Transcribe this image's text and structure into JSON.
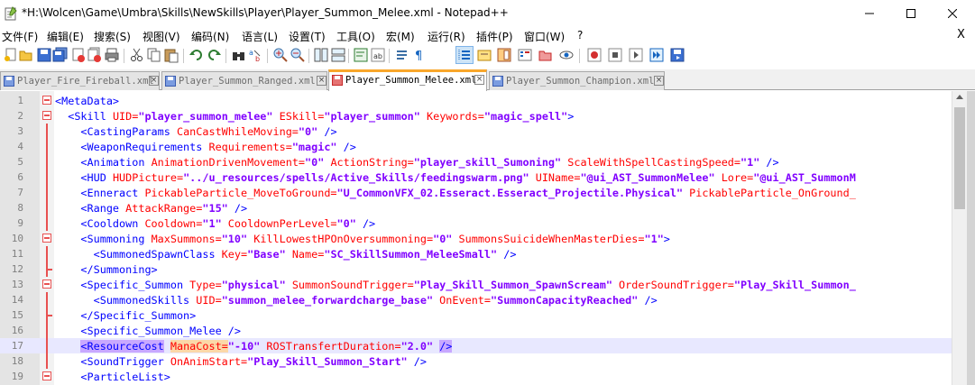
{
  "window": {
    "title": "*H:\\Wolcen\\Game\\Umbra\\Skills\\NewSkills\\Player\\Player_Summon_Melee.xml - Notepad++",
    "minimize": "—",
    "maximize": "☐",
    "close": "✕"
  },
  "menu": {
    "items": [
      "文件(F)",
      "编辑(E)",
      "搜索(S)",
      "视图(V)",
      "编码(N)",
      "语言(L)",
      "设置(T)",
      "工具(O)",
      "宏(M)",
      "运行(R)",
      "插件(P)",
      "窗口(W)",
      "?"
    ],
    "close_doc": "X"
  },
  "tabs": [
    {
      "label": "Player_Fire_Fireball.xml",
      "active": false
    },
    {
      "label": "Player_Summon_Ranged.xml",
      "active": false
    },
    {
      "label": "Player_Summon_Melee.xml",
      "active": true
    },
    {
      "label": "Player_Summon_Champion.xml",
      "active": false
    }
  ],
  "editor": {
    "current_line": 17,
    "lines": [
      {
        "n": "1",
        "parts": [
          [
            "t",
            "<MetaData>"
          ]
        ]
      },
      {
        "n": "2",
        "parts": [
          [
            "p",
            "  "
          ],
          [
            "t",
            "<Skill "
          ],
          [
            "a",
            "UID="
          ],
          [
            "v",
            "\"player_summon_melee\""
          ],
          [
            "a",
            " ESkill="
          ],
          [
            "v",
            "\"player_summon\""
          ],
          [
            "a",
            " Keywords="
          ],
          [
            "v",
            "\"magic_spell\""
          ],
          [
            "t",
            ">"
          ]
        ]
      },
      {
        "n": "3",
        "parts": [
          [
            "p",
            "    "
          ],
          [
            "t",
            "<CastingParams "
          ],
          [
            "a",
            "CanCastWhileMoving="
          ],
          [
            "v",
            "\"0\""
          ],
          [
            "t",
            " />"
          ]
        ]
      },
      {
        "n": "4",
        "parts": [
          [
            "p",
            "    "
          ],
          [
            "t",
            "<WeaponRequirements "
          ],
          [
            "a",
            "Requirements="
          ],
          [
            "v",
            "\"magic\""
          ],
          [
            "t",
            " />"
          ]
        ]
      },
      {
        "n": "5",
        "parts": [
          [
            "p",
            "    "
          ],
          [
            "t",
            "<Animation "
          ],
          [
            "a",
            "AnimationDrivenMovement="
          ],
          [
            "v",
            "\"0\""
          ],
          [
            "a",
            " ActionString="
          ],
          [
            "v",
            "\"player_skill_Sumoning\""
          ],
          [
            "a",
            " ScaleWithSpellCastingSpeed="
          ],
          [
            "v",
            "\"1\""
          ],
          [
            "t",
            " />"
          ]
        ]
      },
      {
        "n": "6",
        "parts": [
          [
            "p",
            "    "
          ],
          [
            "t",
            "<HUD "
          ],
          [
            "a",
            "HUDPicture="
          ],
          [
            "v",
            "\"../u_resources/spells/Active_Skills/feedingswarm.png\""
          ],
          [
            "a",
            " UIName="
          ],
          [
            "v",
            "\"@ui_AST_SummonMelee\""
          ],
          [
            "a",
            " Lore="
          ],
          [
            "v",
            "\"@ui_AST_SummonM"
          ]
        ]
      },
      {
        "n": "7",
        "parts": [
          [
            "p",
            "    "
          ],
          [
            "t",
            "<Enneract "
          ],
          [
            "a",
            "PickableParticle_MoveToGround="
          ],
          [
            "v",
            "\"U_CommonVFX_02.Esseract.Esseract_Projectile.Physical\""
          ],
          [
            "a",
            " PickableParticle_OnGround_"
          ]
        ]
      },
      {
        "n": "8",
        "parts": [
          [
            "p",
            "    "
          ],
          [
            "t",
            "<Range "
          ],
          [
            "a",
            "AttackRange="
          ],
          [
            "v",
            "\"15\""
          ],
          [
            "t",
            " />"
          ]
        ]
      },
      {
        "n": "9",
        "parts": [
          [
            "p",
            "    "
          ],
          [
            "t",
            "<Cooldown "
          ],
          [
            "a",
            "Cooldown="
          ],
          [
            "v",
            "\"1\""
          ],
          [
            "a",
            " CooldownPerLevel="
          ],
          [
            "v",
            "\"0\""
          ],
          [
            "t",
            " />"
          ]
        ]
      },
      {
        "n": "10",
        "parts": [
          [
            "p",
            "    "
          ],
          [
            "t",
            "<Summoning "
          ],
          [
            "a",
            "MaxSummons="
          ],
          [
            "v",
            "\"10\""
          ],
          [
            "a",
            " KillLowestHPOnOversummoning="
          ],
          [
            "v",
            "\"0\""
          ],
          [
            "a",
            " SummonsSuicideWhenMasterDies="
          ],
          [
            "v",
            "\"1\""
          ],
          [
            "t",
            ">"
          ]
        ]
      },
      {
        "n": "11",
        "parts": [
          [
            "p",
            "      "
          ],
          [
            "t",
            "<SummonedSpawnClass "
          ],
          [
            "a",
            "Key="
          ],
          [
            "v",
            "\"Base\""
          ],
          [
            "a",
            " Name="
          ],
          [
            "v",
            "\"SC_SkillSummon_MeleeSmall\""
          ],
          [
            "t",
            " />"
          ]
        ]
      },
      {
        "n": "12",
        "parts": [
          [
            "p",
            "    "
          ],
          [
            "t",
            "</Summoning>"
          ]
        ]
      },
      {
        "n": "13",
        "parts": [
          [
            "p",
            "    "
          ],
          [
            "t",
            "<Specific_Summon "
          ],
          [
            "a",
            "Type="
          ],
          [
            "v",
            "\"physical\""
          ],
          [
            "a",
            " SummonSoundTrigger="
          ],
          [
            "v",
            "\"Play_Skill_Summon_SpawnScream\""
          ],
          [
            "a",
            " OrderSoundTrigger="
          ],
          [
            "v",
            "\"Play_Skill_Summon_"
          ]
        ]
      },
      {
        "n": "14",
        "parts": [
          [
            "p",
            "      "
          ],
          [
            "t",
            "<SummonedSkills "
          ],
          [
            "a",
            "UID="
          ],
          [
            "v",
            "\"summon_melee_forwardcharge_base\""
          ],
          [
            "a",
            " OnEvent="
          ],
          [
            "v",
            "\"SummonCapacityReached\""
          ],
          [
            "t",
            " />"
          ]
        ]
      },
      {
        "n": "15",
        "parts": [
          [
            "p",
            "    "
          ],
          [
            "t",
            "</Specific_Summon>"
          ]
        ]
      },
      {
        "n": "16",
        "parts": [
          [
            "p",
            "    "
          ],
          [
            "t",
            "<Specific_Summon_Melee />"
          ]
        ]
      },
      {
        "n": "17",
        "parts": [
          [
            "p",
            "    "
          ],
          [
            "tm",
            "<ResourceCost"
          ],
          [
            "t",
            " "
          ],
          [
            "ao",
            "ManaCost="
          ],
          [
            "v",
            "\"-10\""
          ],
          [
            "a",
            " ROSTransfertDuration="
          ],
          [
            "v",
            "\"2.0\""
          ],
          [
            "t",
            " "
          ],
          [
            "tm",
            "/>"
          ]
        ]
      },
      {
        "n": "18",
        "parts": [
          [
            "p",
            "    "
          ],
          [
            "t",
            "<SoundTrigger "
          ],
          [
            "a",
            "OnAnimStart="
          ],
          [
            "v",
            "\"Play_Skill_Summon_Start\""
          ],
          [
            "t",
            " />"
          ]
        ]
      },
      {
        "n": "19",
        "parts": [
          [
            "p",
            "    "
          ],
          [
            "t",
            "<ParticleList>"
          ]
        ]
      }
    ]
  }
}
